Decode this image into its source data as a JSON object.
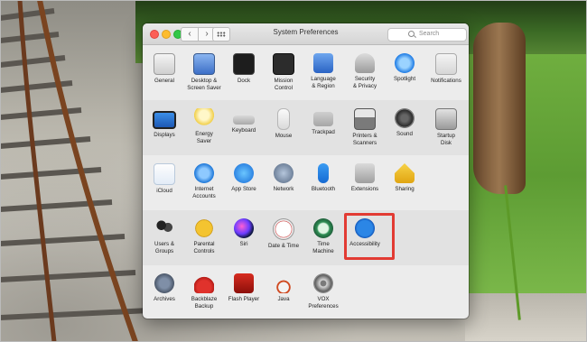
{
  "window": {
    "title": "System Preferences",
    "search_placeholder": "Search",
    "back_glyph": "‹",
    "forward_glyph": "›"
  },
  "rows": [
    [
      {
        "label": "General",
        "icon": "general-icon"
      },
      {
        "label": "Desktop &\nScreen Saver",
        "icon": "desktop-screensaver-icon"
      },
      {
        "label": "Dock",
        "icon": "dock-icon"
      },
      {
        "label": "Mission\nControl",
        "icon": "mission-control-icon"
      },
      {
        "label": "Language\n& Region",
        "icon": "language-region-icon"
      },
      {
        "label": "Security\n& Privacy",
        "icon": "security-privacy-icon"
      },
      {
        "label": "Spotlight",
        "icon": "spotlight-icon"
      },
      {
        "label": "Notifications",
        "icon": "notifications-icon"
      }
    ],
    [
      {
        "label": "Displays",
        "icon": "displays-icon"
      },
      {
        "label": "Energy\nSaver",
        "icon": "energy-saver-icon"
      },
      {
        "label": "Keyboard",
        "icon": "keyboard-icon"
      },
      {
        "label": "Mouse",
        "icon": "mouse-icon"
      },
      {
        "label": "Trackpad",
        "icon": "trackpad-icon"
      },
      {
        "label": "Printers &\nScanners",
        "icon": "printers-scanners-icon"
      },
      {
        "label": "Sound",
        "icon": "sound-icon"
      },
      {
        "label": "Startup\nDisk",
        "icon": "startup-disk-icon"
      }
    ],
    [
      {
        "label": "iCloud",
        "icon": "icloud-icon"
      },
      {
        "label": "Internet\nAccounts",
        "icon": "internet-accounts-icon"
      },
      {
        "label": "App Store",
        "icon": "app-store-icon"
      },
      {
        "label": "Network",
        "icon": "network-icon"
      },
      {
        "label": "Bluetooth",
        "icon": "bluetooth-icon"
      },
      {
        "label": "Extensions",
        "icon": "extensions-icon"
      },
      {
        "label": "Sharing",
        "icon": "sharing-icon"
      }
    ],
    [
      {
        "label": "Users &\nGroups",
        "icon": "users-groups-icon"
      },
      {
        "label": "Parental\nControls",
        "icon": "parental-controls-icon"
      },
      {
        "label": "Siri",
        "icon": "siri-icon"
      },
      {
        "label": "Date & Time",
        "icon": "date-time-icon"
      },
      {
        "label": "Time\nMachine",
        "icon": "time-machine-icon"
      },
      {
        "label": "Accessibility",
        "icon": "accessibility-icon"
      }
    ],
    [
      {
        "label": "Archives",
        "icon": "archives-icon"
      },
      {
        "label": "Backblaze\nBackup",
        "icon": "backblaze-backup-icon"
      },
      {
        "label": "Flash Player",
        "icon": "flash-player-icon"
      },
      {
        "label": "Java",
        "icon": "java-icon"
      },
      {
        "label": "VOX Preferences",
        "icon": "vox-preferences-icon"
      }
    ]
  ],
  "highlighted_pane": "Accessibility",
  "highlight_color": "#e23b33"
}
